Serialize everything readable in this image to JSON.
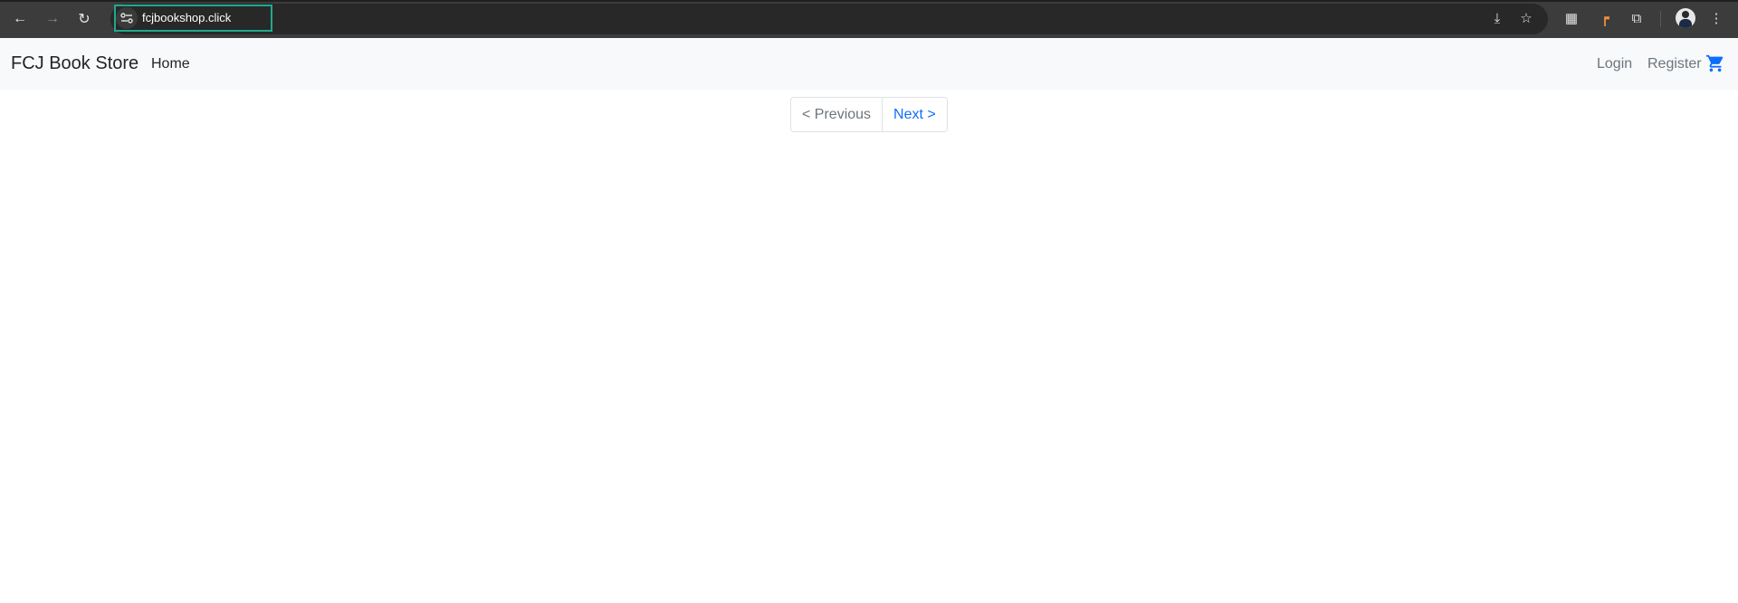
{
  "browser": {
    "url": "fcjbookshop.click",
    "icons": {
      "back": "arrow-left-icon",
      "forward": "arrow-right-icon",
      "reload": "reload-icon",
      "site_info": "tune-icon",
      "install": "install-app-icon",
      "bookmark": "star-icon",
      "qr": "qr-code-icon",
      "extension_orange": "extension-icon",
      "extensions": "puzzle-icon",
      "profile": "avatar",
      "menu": "kebab-menu-icon"
    },
    "glyphs": {
      "back": "←",
      "forward": "→",
      "reload": "↻",
      "install": "⤓",
      "bookmark": "☆",
      "qr": "▦",
      "extension_orange": "┍",
      "extensions": "⧉",
      "menu": "⋮"
    },
    "accent_color": "#1fa98e"
  },
  "navbar": {
    "brand": "FCJ Book Store",
    "links": {
      "home": "Home",
      "login": "Login",
      "register": "Register"
    },
    "cart_icon": "cart-icon",
    "cart_color": "#0d6efd"
  },
  "pagination": {
    "previous": "< Previous",
    "next": "Next >"
  }
}
